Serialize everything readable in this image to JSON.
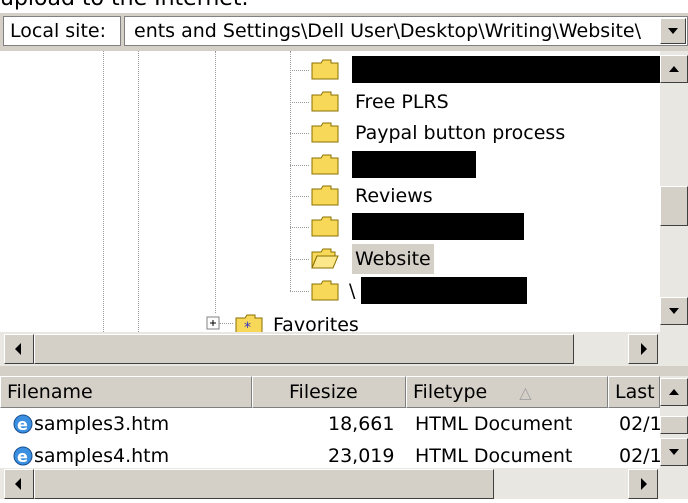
{
  "header_cut": "upload to the Internet.",
  "local_site": {
    "label": "Local site:",
    "path": "ents and Settings\\Dell User\\Desktop\\Writing\\Website\\"
  },
  "tree": {
    "items": [
      {
        "label": "",
        "redacted": true
      },
      {
        "label": "Free PLRS",
        "redacted": false
      },
      {
        "label": "Paypal button process",
        "redacted": false
      },
      {
        "label": "",
        "redacted": true
      },
      {
        "label": "Reviews",
        "redacted": false
      },
      {
        "label": "",
        "redacted": true
      },
      {
        "label": "Website",
        "redacted": false,
        "selected": true,
        "open": true
      },
      {
        "label": "\\",
        "redacted": true
      }
    ],
    "favorites_label": "Favorites"
  },
  "file_list": {
    "columns": [
      "Filename",
      "Filesize",
      "Filetype",
      "Last"
    ],
    "sort_indicator": "△",
    "rows": [
      {
        "name": "samples3.htm",
        "size": "18,661",
        "type": "HTML Document",
        "modified": "02/1"
      },
      {
        "name": "samples4.htm",
        "size": "23,019",
        "type": "HTML Document",
        "modified": "02/1"
      }
    ]
  },
  "colors": {
    "chrome": "#d4d0c8",
    "folder": "#f8d858",
    "selection": "#d4d0c8",
    "redaction": "#000000"
  },
  "icons": [
    "folder-icon",
    "open-folder-icon",
    "favorites-folder-icon",
    "ie-document-icon",
    "plus-expander-icon",
    "arrow-up-icon",
    "arrow-down-icon",
    "arrow-left-icon",
    "arrow-right-icon"
  ]
}
